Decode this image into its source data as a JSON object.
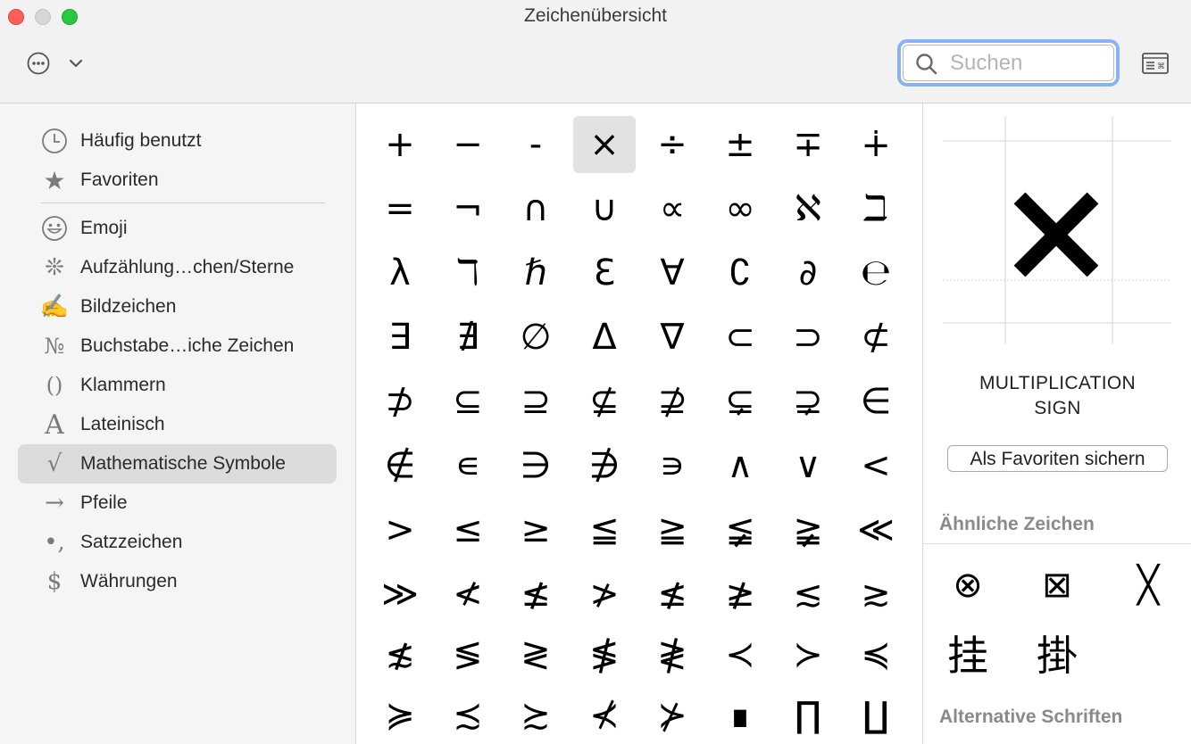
{
  "window": {
    "title": "Zeichenübersicht"
  },
  "search": {
    "placeholder": "Suchen",
    "value": ""
  },
  "sidebar": {
    "items": [
      {
        "id": "haeufig",
        "label": "Häufig benutzt",
        "icon": "clock-icon",
        "glyph": ""
      },
      {
        "id": "favoriten",
        "label": "Favoriten",
        "icon": "star-icon",
        "glyph": "★"
      },
      {
        "id": "emoji",
        "label": "Emoji",
        "icon": "smiley-icon",
        "glyph": ""
      },
      {
        "id": "aufzaehlung",
        "label": "Aufzählung…chen/Sterne",
        "icon": "asterisk-icon",
        "glyph": "❊"
      },
      {
        "id": "bildzeichen",
        "label": "Bildzeichen",
        "icon": "pen-icon",
        "glyph": "✍"
      },
      {
        "id": "buchstaben",
        "label": "Buchstabe…iche Zeichen",
        "icon": "numero-icon",
        "glyph": "№"
      },
      {
        "id": "klammern",
        "label": "Klammern",
        "icon": "parentheses-icon",
        "glyph": "()"
      },
      {
        "id": "lateinisch",
        "label": "Lateinisch",
        "icon": "letter-a-icon",
        "glyph": "A"
      },
      {
        "id": "mathematisch",
        "label": "Mathematische Symbole",
        "icon": "square-root-icon",
        "glyph": "√",
        "selected": true
      },
      {
        "id": "pfeile",
        "label": "Pfeile",
        "icon": "arrow-icon",
        "glyph": "→"
      },
      {
        "id": "satzzeichen",
        "label": "Satzzeichen",
        "icon": "punctuation-icon",
        "glyph": "•,"
      },
      {
        "id": "waehrungen",
        "label": "Währungen",
        "icon": "dollar-icon",
        "glyph": "$"
      }
    ]
  },
  "grid": {
    "selected_index": 3,
    "chars": [
      "+",
      "−",
      "-",
      "×",
      "÷",
      "±",
      "∓",
      "∔",
      "=",
      "¬",
      "∩",
      "∪",
      "∝",
      "∞",
      "ℵ",
      "ℶ",
      "λ",
      "ℸ",
      "ℏ",
      "ℇ",
      "∀",
      "∁",
      "∂",
      "℮",
      "∃",
      "∄",
      "∅",
      "Δ",
      "∇",
      "⊂",
      "⊃",
      "⊄",
      "⊅",
      "⊆",
      "⊇",
      "⊈",
      "⊉",
      "⊊",
      "⊋",
      "∈",
      "∉",
      "∊",
      "∋",
      "∌",
      "∍",
      "∧",
      "∨",
      "<",
      ">",
      "≤",
      "≥",
      "≦",
      "≧",
      "≨",
      "≩",
      "≪",
      "≫",
      "≮",
      "≰",
      "≯",
      "≰",
      "≱",
      "≲",
      "≳",
      "≴",
      "≶",
      "≷",
      "≸",
      "≹",
      "≺",
      "≻",
      "≼",
      "≽",
      "≾",
      "≿",
      "⊀",
      "⊁",
      "∎",
      "∏",
      "∐"
    ]
  },
  "detail": {
    "preview_char": "×",
    "name": "MULTIPLICATION SIGN",
    "favorite_button": "Als Favoriten sichern",
    "similar_title": "Ähnliche Zeichen",
    "similar": [
      "⊗",
      "⊠",
      "╳",
      "挂",
      "掛"
    ],
    "alt_fonts_title": "Alternative Schriften"
  },
  "colors": {
    "accent_focus": "#8ab3f5",
    "selection": "#dcdcdc",
    "sidebar_bg": "#f5f5f5"
  }
}
